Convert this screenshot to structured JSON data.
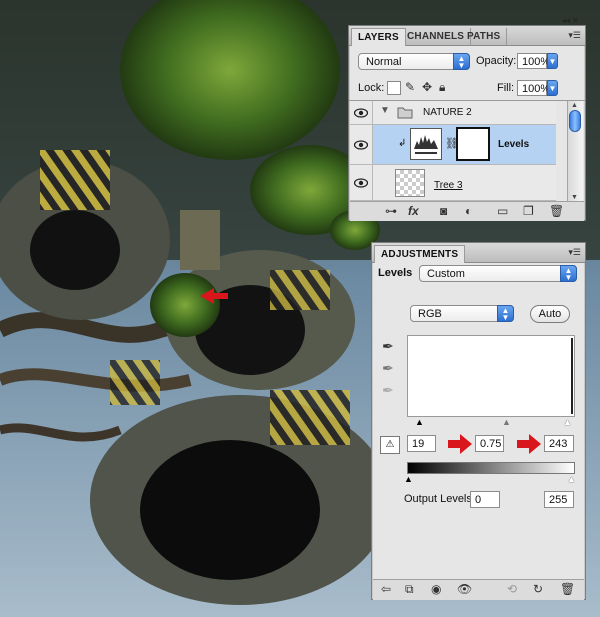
{
  "layers_panel": {
    "tabs": [
      {
        "label": "LAYERS",
        "active": true
      },
      {
        "label": "CHANNELS",
        "active": false
      },
      {
        "label": "PATHS",
        "active": false
      }
    ],
    "blend_mode": "Normal",
    "opacity_label": "Opacity:",
    "opacity_value": "100%",
    "lock_label": "Lock:",
    "fill_label": "Fill:",
    "fill_value": "100%",
    "layers": [
      {
        "name": "NATURE 2",
        "type": "group",
        "visible": true
      },
      {
        "name": "Levels",
        "type": "adjustment",
        "visible": true,
        "selected": true
      },
      {
        "name": "Tree 3",
        "type": "pixel",
        "visible": true
      }
    ],
    "bottom_icons": [
      "link-icon",
      "fx-icon",
      "mask-icon",
      "adjustment-icon",
      "group-folder-icon",
      "new-layer-icon",
      "trash-icon"
    ]
  },
  "adjustments_panel": {
    "tab_label": "ADJUSTMENTS",
    "type_label": "Levels",
    "preset_value": "Custom",
    "channel_value": "RGB",
    "auto_label": "Auto",
    "input_black": "19",
    "input_gamma": "0.75",
    "input_white": "243",
    "output_label": "Output Levels:",
    "output_black": "0",
    "output_white": "255",
    "bottom_icons": [
      "back-icon",
      "expand-icon",
      "clip-icon",
      "visibility-icon",
      "previous-state-icon",
      "reset-icon",
      "trash-icon"
    ]
  },
  "colors": {
    "selection_highlight": "#b5d2f3",
    "accent_blue": "#2d6fd2",
    "annotation_red": "#d9161c",
    "sky": "#6f8ea6"
  }
}
